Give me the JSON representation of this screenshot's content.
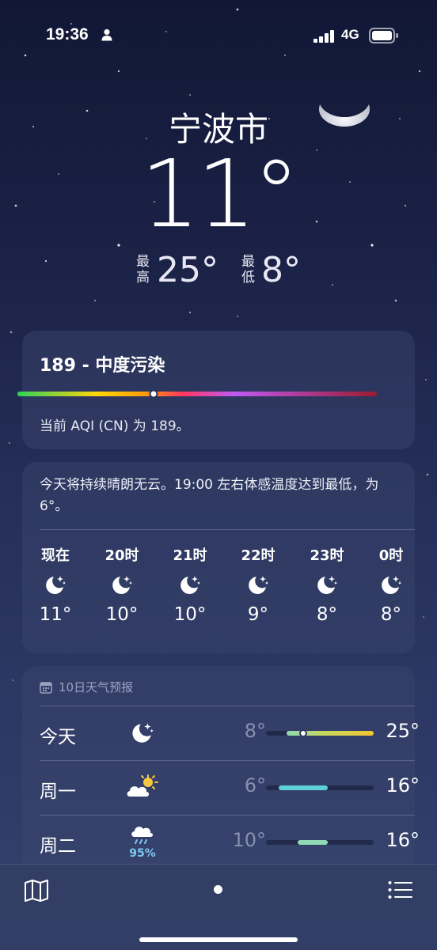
{
  "status_bar": {
    "time": "19:36",
    "network": "4G"
  },
  "location": {
    "city": "宁波市",
    "temperature": "11°"
  },
  "high_low": {
    "high_label": "最高",
    "high": "25°",
    "low_label": "最低",
    "low": "8°"
  },
  "aqi": {
    "title": "189 - 中度污染",
    "description": "当前 AQI (CN) 为 189。",
    "gradient": [
      "#30d158",
      "#ffd60a",
      "#ff9f0a",
      "#ff375f",
      "#bf5af2",
      "#9b1b30"
    ]
  },
  "hourly": {
    "summary": "今天将持续晴朗无云。19:00 左右体感温度达到最低，为 6°。",
    "hours": [
      {
        "label": "现在",
        "icon": "moon-stars-icon",
        "temp": "11°"
      },
      {
        "label": "20时",
        "icon": "moon-stars-icon",
        "temp": "10°"
      },
      {
        "label": "21时",
        "icon": "moon-stars-icon",
        "temp": "10°"
      },
      {
        "label": "22时",
        "icon": "moon-stars-icon",
        "temp": "9°"
      },
      {
        "label": "23时",
        "icon": "moon-stars-icon",
        "temp": "8°"
      },
      {
        "label": "0时",
        "icon": "moon-stars-icon",
        "temp": "8°"
      }
    ]
  },
  "daily": {
    "header": "10日天气预报",
    "days": [
      {
        "day": "今天",
        "icon": "moon-stars-icon",
        "low": "8°",
        "high": "25°",
        "precip": ""
      },
      {
        "day": "周一",
        "icon": "partly-sunny-icon",
        "low": "6°",
        "high": "16°",
        "precip": ""
      },
      {
        "day": "周二",
        "icon": "rain-icon",
        "low": "10°",
        "high": "16°",
        "precip": "95%"
      }
    ]
  },
  "colors": {
    "accent_rain": "#7cc6f2",
    "bar_warm": "#f2c530",
    "bar_cool": "#5ed0d8",
    "bar_mild": "#8fd9b4"
  }
}
